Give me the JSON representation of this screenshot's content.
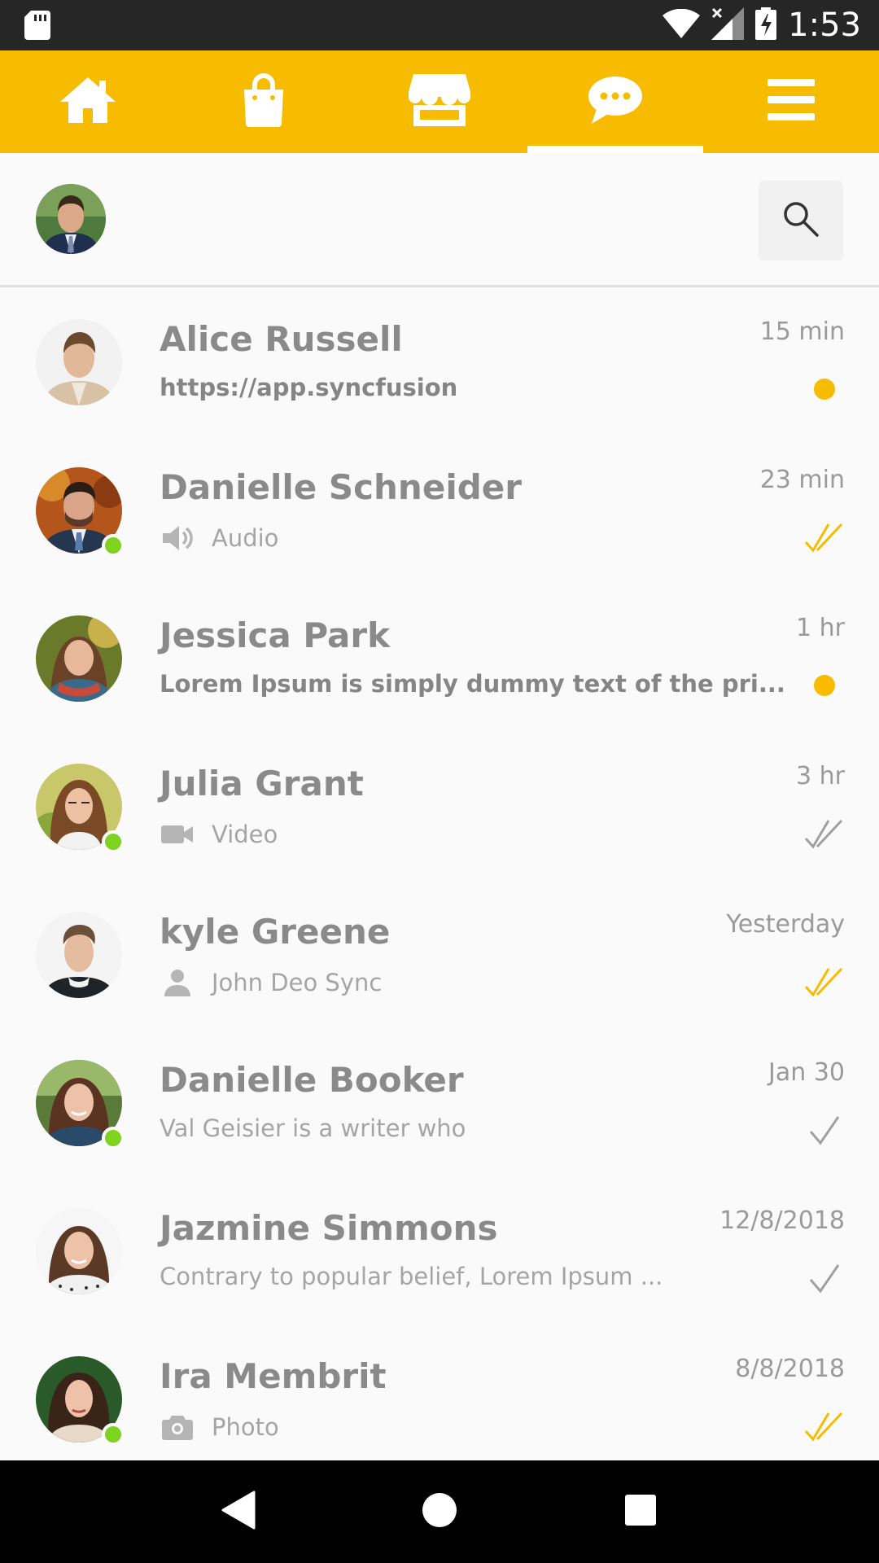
{
  "status_bar": {
    "time": "1:53"
  },
  "nav": {
    "tabs": [
      {
        "icon": "home-icon"
      },
      {
        "icon": "shopping-bag-icon"
      },
      {
        "icon": "store-icon"
      },
      {
        "icon": "chat-icon",
        "active": true
      },
      {
        "icon": "menu-icon"
      }
    ]
  },
  "colors": {
    "accent": "#f7bb00",
    "online": "#7ed321",
    "read_grey": "#a0a0a0"
  },
  "chats": [
    {
      "name": "Alice Russell",
      "time": "15 min",
      "preview": "https://app.syncfusion",
      "preview_icon": null,
      "unread": true,
      "status": "unread-dot",
      "online": false
    },
    {
      "name": "Danielle Schneider",
      "time": "23 min",
      "preview": "Audio",
      "preview_icon": "speaker-icon",
      "unread": false,
      "status": "read-double-check",
      "online": true
    },
    {
      "name": "Jessica Park",
      "time": "1 hr",
      "preview": "Lorem Ipsum is simply dummy text of the pri...",
      "preview_icon": null,
      "unread": true,
      "status": "unread-dot",
      "online": false
    },
    {
      "name": "Julia Grant",
      "time": "3 hr",
      "preview": "Video",
      "preview_icon": "video-icon",
      "unread": false,
      "status": "delivered-double-check",
      "online": true
    },
    {
      "name": "kyle Greene",
      "time": "Yesterday",
      "preview": "John Deo Sync",
      "preview_icon": "person-icon",
      "unread": false,
      "status": "read-double-check",
      "online": false
    },
    {
      "name": "Danielle Booker",
      "time": "Jan 30",
      "preview": "Val Geisier is a writer who",
      "preview_icon": null,
      "unread": false,
      "status": "sent-check",
      "online": true
    },
    {
      "name": "Jazmine Simmons",
      "time": "12/8/2018",
      "preview": "Contrary to popular belief, Lorem Ipsum ...",
      "preview_icon": null,
      "unread": false,
      "status": "sent-check",
      "online": false
    },
    {
      "name": "Ira Membrit",
      "time": "8/8/2018",
      "preview": "Photo",
      "preview_icon": "camera-icon",
      "unread": false,
      "status": "read-double-check",
      "online": true
    }
  ]
}
